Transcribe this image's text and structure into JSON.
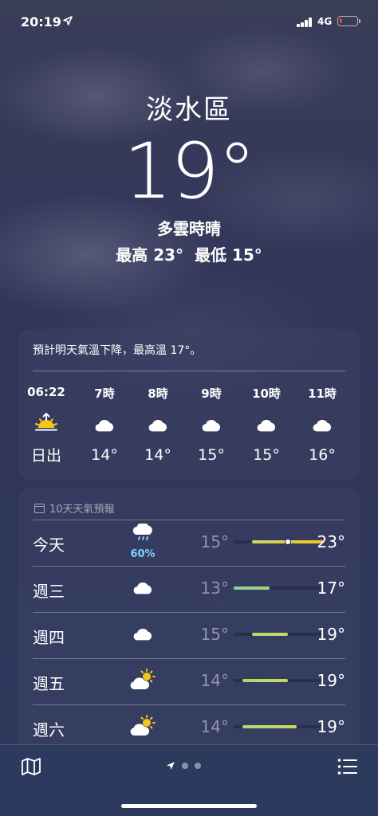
{
  "status_bar": {
    "time": "20:19",
    "network": "4G"
  },
  "location": {
    "city": "淡水區",
    "temperature": "19°",
    "condition": "多雲時晴",
    "high_low": "最高 23°  最低 15°"
  },
  "hourly": {
    "summary": "預計明天氣溫下降，最高溫 17°。",
    "items": [
      {
        "time": "06:22",
        "icon": "sunrise-icon",
        "value": "日出"
      },
      {
        "time": "7時",
        "icon": "cloud-icon",
        "value": "14°"
      },
      {
        "time": "8時",
        "icon": "cloud-icon",
        "value": "14°"
      },
      {
        "time": "9時",
        "icon": "cloud-icon",
        "value": "15°"
      },
      {
        "time": "10時",
        "icon": "cloud-icon",
        "value": "15°"
      },
      {
        "time": "11時",
        "icon": "cloud-icon",
        "value": "16°"
      }
    ]
  },
  "daily": {
    "header": "10天天氣預報",
    "range": {
      "min": 13,
      "max": 23
    },
    "days": [
      {
        "day": "今天",
        "icon": "cloud-rain-icon",
        "precip": "60%",
        "low": "15°",
        "high": "23°",
        "low_val": 15,
        "high_val": 23,
        "current_val": 19,
        "colors": [
          "#c8d86a",
          "#f2c71a"
        ]
      },
      {
        "day": "週三",
        "icon": "cloud-icon",
        "precip": "",
        "low": "13°",
        "high": "17°",
        "low_val": 13,
        "high_val": 17,
        "colors": [
          "#8ad39a",
          "#a6d47a"
        ]
      },
      {
        "day": "週四",
        "icon": "cloud-icon",
        "precip": "",
        "low": "15°",
        "high": "19°",
        "low_val": 15,
        "high_val": 19,
        "colors": [
          "#b7d86f",
          "#c4d962"
        ]
      },
      {
        "day": "週五",
        "icon": "partly-sunny-icon",
        "precip": "",
        "low": "14°",
        "high": "19°",
        "low_val": 14,
        "high_val": 19,
        "colors": [
          "#b0d772",
          "#c4d962"
        ]
      },
      {
        "day": "週六",
        "icon": "partly-sunny-icon",
        "precip": "",
        "low": "14°",
        "high": "19°",
        "low_val": 14,
        "high_val": 20,
        "colors": [
          "#b0d772",
          "#c8d95c"
        ]
      }
    ]
  },
  "bottom_bar": {
    "page_count": 3,
    "current_page": 0
  }
}
